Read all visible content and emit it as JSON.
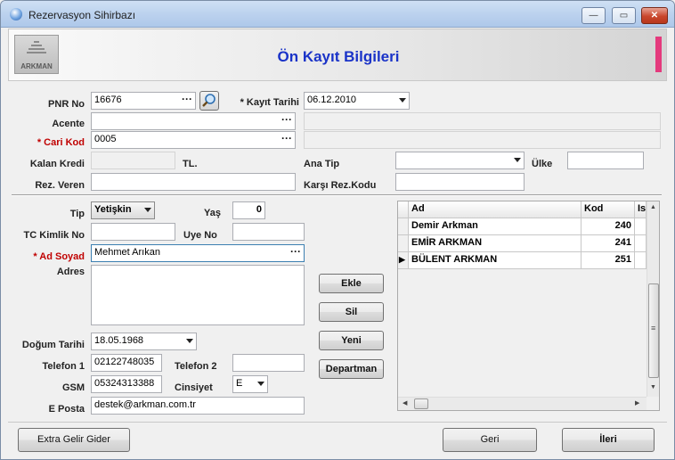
{
  "window": {
    "title": "Rezervasyon Sihirbazı"
  },
  "header": {
    "title": "Ön Kayıt Bilgileri",
    "logo_text": "ARKMAN"
  },
  "labels": {
    "pnr_no": "PNR No",
    "kayit_tarihi": "* Kayıt Tarihi",
    "acente": "Acente",
    "cari_kod": "* Cari Kod",
    "kalan_kredi": "Kalan Kredi",
    "tl": "TL.",
    "ana_tip": "Ana Tip",
    "ulke": "Ülke",
    "rez_veren": "Rez. Veren",
    "karsi_rez_kodu": "Karşı Rez.Kodu",
    "tip": "Tip",
    "yas": "Yaş",
    "tc_kimlik_no": "TC Kimlik No",
    "uye_no": "Uye No",
    "ad_soyad": "* Ad Soyad",
    "adres": "Adres",
    "dogum_tarihi": "Doğum Tarihi",
    "telefon1": "Telefon 1",
    "telefon2": "Telefon 2",
    "gsm": "GSM",
    "cinsiyet": "Cinsiyet",
    "e_posta": "E Posta"
  },
  "values": {
    "pnr_no": "16676",
    "kayit_tarihi": "06.12.2010",
    "acente": "",
    "cari_kod": "0005",
    "kalan_kredi": "",
    "ana_tip": "",
    "ulke": "",
    "rez_veren": "",
    "karsi_rez_kodu": "",
    "tip": "Yetişkin",
    "yas": "0",
    "tc_kimlik_no": "",
    "uye_no": "",
    "ad_soyad": "Mehmet Arıkan",
    "adres": "",
    "dogum_tarihi": "18.05.1968",
    "telefon1": "02122748035",
    "telefon2": "",
    "gsm": "05324313388",
    "cinsiyet": "E",
    "e_posta": "destek@arkman.com.tr"
  },
  "side_buttons": {
    "ekle": "Ekle",
    "sil": "Sil",
    "yeni": "Yeni",
    "departman": "Departman"
  },
  "grid": {
    "columns": [
      "Ad",
      "Kod",
      "Is"
    ],
    "rows": [
      {
        "ad": "Demir Arkman",
        "kod": "240"
      },
      {
        "ad": "EMİR ARKMAN",
        "kod": "241"
      },
      {
        "ad": "BÜLENT ARKMAN",
        "kod": "251"
      }
    ]
  },
  "footer": {
    "extra": "Extra Gelir Gider",
    "geri": "Geri",
    "ileri": "İleri"
  },
  "glyphs": {
    "dots": "···",
    "minimize": "—",
    "maximize": "▭",
    "close": "✕",
    "row_pointer": "▶",
    "scroll_up": "▲",
    "scroll_down": "▼",
    "scroll_left": "◀",
    "scroll_right": "▶",
    "grip": "≡"
  },
  "colors": {
    "title_blue": "#1a33c8",
    "required_red": "#c00000",
    "accent_pink": "#e43a7d"
  }
}
